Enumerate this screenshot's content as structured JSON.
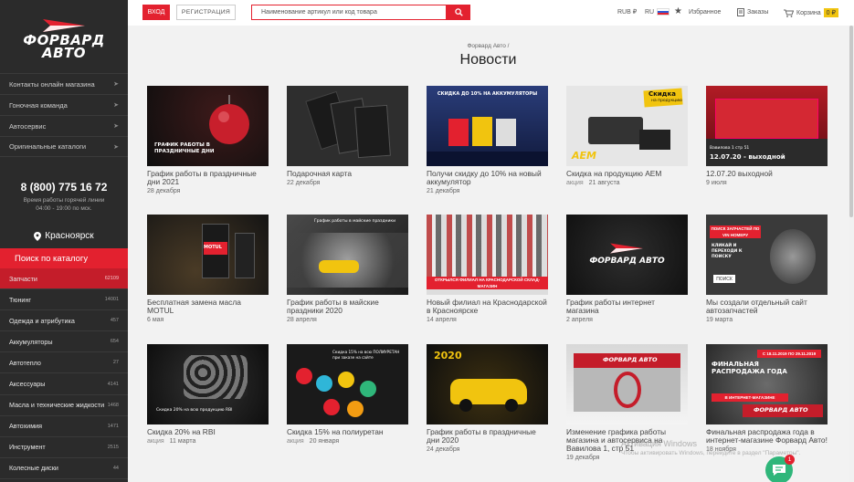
{
  "brand": {
    "name": "ФОРВАРД АВТО"
  },
  "sidebar": {
    "top_menu": [
      {
        "label": "Контакты онлайн магазина"
      },
      {
        "label": "Гоночная команда"
      },
      {
        "label": "Автосервис"
      },
      {
        "label": "Оригинальные каталоги"
      }
    ],
    "phone": "8 (800) 775 16 72",
    "hotline_1": "Время работы горячей линии",
    "hotline_2": "04:00 - 19:00 по мск.",
    "city": "Красноярск",
    "catalog_button": "Поиск по каталогу",
    "categories": [
      {
        "label": "Запчасти",
        "count": "62109"
      },
      {
        "label": "Тюнинг",
        "count": "14001"
      },
      {
        "label": "Одежда и атрибутика",
        "count": "457"
      },
      {
        "label": "Аккумуляторы",
        "count": "654"
      },
      {
        "label": "Автотепло",
        "count": "27"
      },
      {
        "label": "Аксессуары",
        "count": "4141"
      },
      {
        "label": "Масла и технические жидкости",
        "count": "1468"
      },
      {
        "label": "Автохимия",
        "count": "1471"
      },
      {
        "label": "Инструмент",
        "count": "2515"
      },
      {
        "label": "Колесные диски",
        "count": "44"
      }
    ]
  },
  "header": {
    "login": "ВХОД",
    "register": "РЕГИСТРАЦИЯ",
    "search_placeholder": "Наименование артикул или код товара",
    "currency": "RUB ₽",
    "lang": "RU",
    "favorites": "Избранное",
    "orders": "Заказы",
    "cart": "Корзина",
    "cart_total": "0 ₽"
  },
  "breadcrumb": "Форвард Авто /",
  "page_title": "Новости",
  "news": [
    {
      "title": "График работы в праздничные дни 2021",
      "date": "28 декабря",
      "tag": ""
    },
    {
      "title": "Подарочная карта",
      "date": "22 декабря",
      "tag": ""
    },
    {
      "title": "Получи скидку до 10% на новый аккумулятор",
      "date": "21 декабря",
      "tag": ""
    },
    {
      "title": "Скидка на продукцию AEM",
      "date": "21 августа",
      "tag": "акция"
    },
    {
      "title": "12.07.20 выходной",
      "date": "9 июля",
      "tag": ""
    },
    {
      "title": "Бесплатная замена масла MOTUL",
      "date": "6 мая",
      "tag": ""
    },
    {
      "title": "График работы в майские праздники 2020",
      "date": "28 апреля",
      "tag": ""
    },
    {
      "title": "Новый филиал на Краснодарской в Красноярске",
      "date": "14 апреля",
      "tag": ""
    },
    {
      "title": "График работы интернет магазина",
      "date": "2 апреля",
      "tag": ""
    },
    {
      "title": "Мы создали отдельный сайт автозапчастей",
      "date": "19 марта",
      "tag": ""
    },
    {
      "title": "Скидка 20% на RBI",
      "date": "11 марта",
      "tag": "акция"
    },
    {
      "title": "Скидка 15% на полиуретан",
      "date": "20 января",
      "tag": "акция"
    },
    {
      "title": "График работы в праздничные дни 2020",
      "date": "24 декабря",
      "tag": ""
    },
    {
      "title": "Изменение графика работы магазина и автосервиса на Вавилова 1, стр 51",
      "date": "19 декабря",
      "tag": ""
    },
    {
      "title": "Финальная распродажа года в интернет-магазине Форвард Авто!",
      "date": "18 ноября",
      "tag": ""
    }
  ],
  "thumb_text": {
    "t1": "ГРАФИК РАБОТЫ В ПРАЗДНИЧНЫЕ ДНИ",
    "t3": "СКИДКА ДО 10% НА АККУМУЛЯТОРЫ",
    "t4_badge": "Скидка",
    "t4_sub": "на продукцию",
    "t4_brand": "AEM",
    "t5": "12.07.20 - выходной",
    "t5_small": "Вавилова 1 стр 51",
    "t6_brand": "MOTUL",
    "t7": "График работы в майские праздники",
    "t8": "ОТКРЫЛСЯ ФИЛИАЛ НА КРАСНОДАРСКОЙ СКЛАД-МАГАЗИН",
    "t10_a": "ПОИСК ЗАПЧАСТЕЙ ПО VIN НОМЕРУ",
    "t10_b": "КЛИКАЙ И ПЕРЕХОДИ К ПОИСКУ",
    "t10_c": "ПОИСК",
    "t11": "Скидка 20% на всю продукцию RBI",
    "t12": "Скидка 15% на всю ПОЛИУРЕТАН при заказе на сайте",
    "t13": "2020",
    "t14": "ФОРВАРД АВТО",
    "t15_a": "ФИНАЛЬНАЯ РАСПРОДАЖА ГОДА",
    "t15_b": "С 18.11.2019 ПО 29.11.2019",
    "t15_c": "В ИНТЕРНЕТ-МАГАЗИНЕ"
  },
  "overlay": {
    "win_1": "Активация Windows",
    "win_2": "Чтобы активировать Windows, перейдите в раздел \"Параметры\".",
    "chat_badge": "1"
  },
  "colors": {
    "accent": "#e3212f",
    "sidebar": "#2b2b2b",
    "chat": "#2fb67a"
  }
}
